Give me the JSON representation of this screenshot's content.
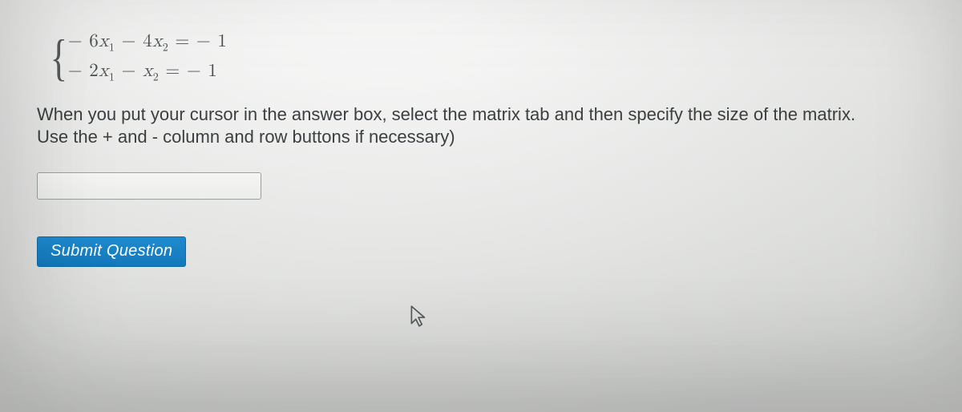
{
  "equations": {
    "line1": "− 6x₁ − 4x₂ = − 1",
    "line2": "− 2x₁ − x₂ = − 1"
  },
  "instructions_line1": "When you put your cursor in the answer box, select the matrix tab and then specify the size of the matrix.",
  "instructions_line2": "Use the + and - column and row buttons if necessary)",
  "answer_value": "",
  "answer_placeholder": "",
  "submit_label": "Submit Question"
}
